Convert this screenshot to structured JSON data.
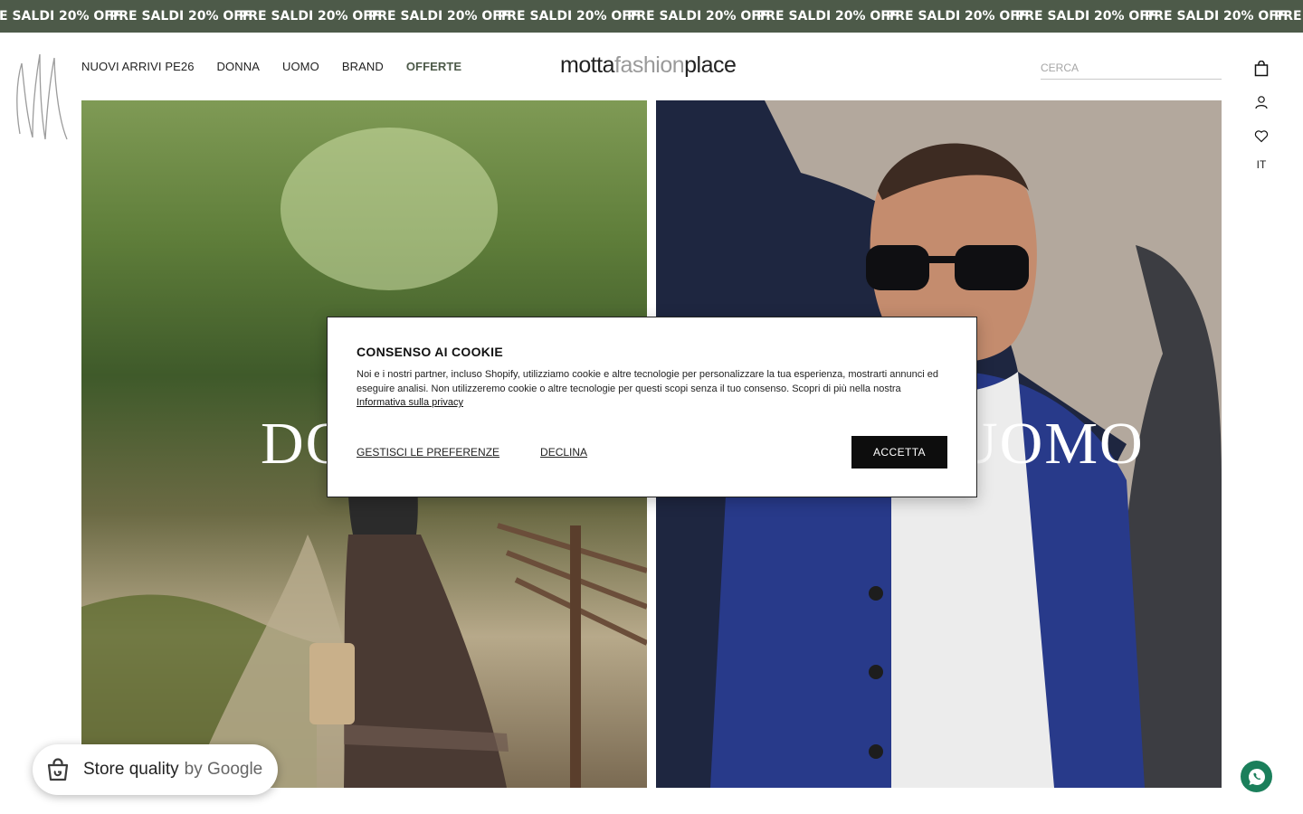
{
  "ticker": {
    "items": [
      "PRE SALDI 20% OFF",
      "PRE SALDI 20% OFF",
      "PRE SALDI 20% OFF",
      "PRE SALDI 20% OFF",
      "PRE SALDI 20% OFF",
      "PRE SALDI 20% OFF",
      "PRE SALDI 20% OFF",
      "PRE SALDI 20% OFF",
      "PRE SALDI 20% OFF",
      "PRE SALDI 20% OFF",
      "PRE SALDI 20% OFF"
    ],
    "background": "#4d5a49"
  },
  "nav": {
    "items": [
      {
        "label": "NUOVI ARRIVI PE26"
      },
      {
        "label": "DONNA"
      },
      {
        "label": "UOMO"
      },
      {
        "label": "BRAND"
      },
      {
        "label": "OFFERTE"
      }
    ],
    "accent": "#4d5a49"
  },
  "brand": {
    "part1": "motta",
    "part2": "fashion",
    "part3": "place"
  },
  "search": {
    "placeholder": "CERCA",
    "value": ""
  },
  "header_icons": {
    "cart": "shopping-bag-icon",
    "account": "user-icon",
    "wishlist": "heart-icon",
    "language": "IT"
  },
  "hero": {
    "left_label": "DONNA",
    "right_label": "UOMO"
  },
  "cookie": {
    "title": "CONSENSO AI COOKIE",
    "body": "Noi e i nostri partner, incluso Shopify, utilizziamo cookie e altre tecnologie per personalizzare la tua esperienza, mostrarti annunci ed eseguire analisi. Non utilizzeremo cookie o altre tecnologie per questi scopi senza il tuo consenso. Scopri di più nella nostra ",
    "privacy_link": "Informativa sulla privacy",
    "manage_label": "GESTISCI LE PREFERENZE",
    "decline_label": "DECLINA",
    "accept_label": "ACCETTA"
  },
  "store_badge": {
    "label": "Store quality",
    "by": "by Google"
  },
  "whatsapp": {
    "icon": "whatsapp-icon",
    "color": "#1b7f5b"
  }
}
